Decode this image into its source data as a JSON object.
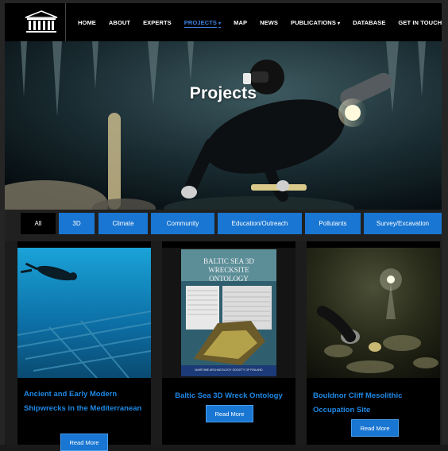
{
  "nav": {
    "items": [
      {
        "label": "HOME"
      },
      {
        "label": "ABOUT"
      },
      {
        "label": "EXPERTS"
      },
      {
        "label": "PROJECTS"
      },
      {
        "label": "MAP"
      },
      {
        "label": "NEWS"
      },
      {
        "label": "PUBLICATIONS"
      },
      {
        "label": "DATABASE"
      },
      {
        "label": "GET IN TOUCH"
      }
    ],
    "active": "PROJECTS",
    "caret": "▾"
  },
  "logo": {
    "text": "UNESCO"
  },
  "hero": {
    "title": "Projects"
  },
  "filters": [
    "All",
    "3D",
    "Climate",
    "Community",
    "Education/Outreach",
    "Pollutants",
    "Survey/Excavation"
  ],
  "cards": [
    {
      "title": "Ancient and Early Modern Shipwrecks in the Mediterranean",
      "button": "Read More"
    },
    {
      "title": "Baltic Sea 3D Wreck Ontology",
      "button": "Read More",
      "poster_title": "BALTIC SEA 3D WRECKSITE ONTOLOGY",
      "poster_footer": "MARITIME ARCHAEOLOGY SOCIETY OF FINLAND"
    },
    {
      "title": "Bouldnor Cliff Mesolithic Occupation Site",
      "button": "Read More"
    }
  ],
  "colors": {
    "accent": "#1976d2",
    "link": "#1e88e5",
    "header": "#000000"
  }
}
